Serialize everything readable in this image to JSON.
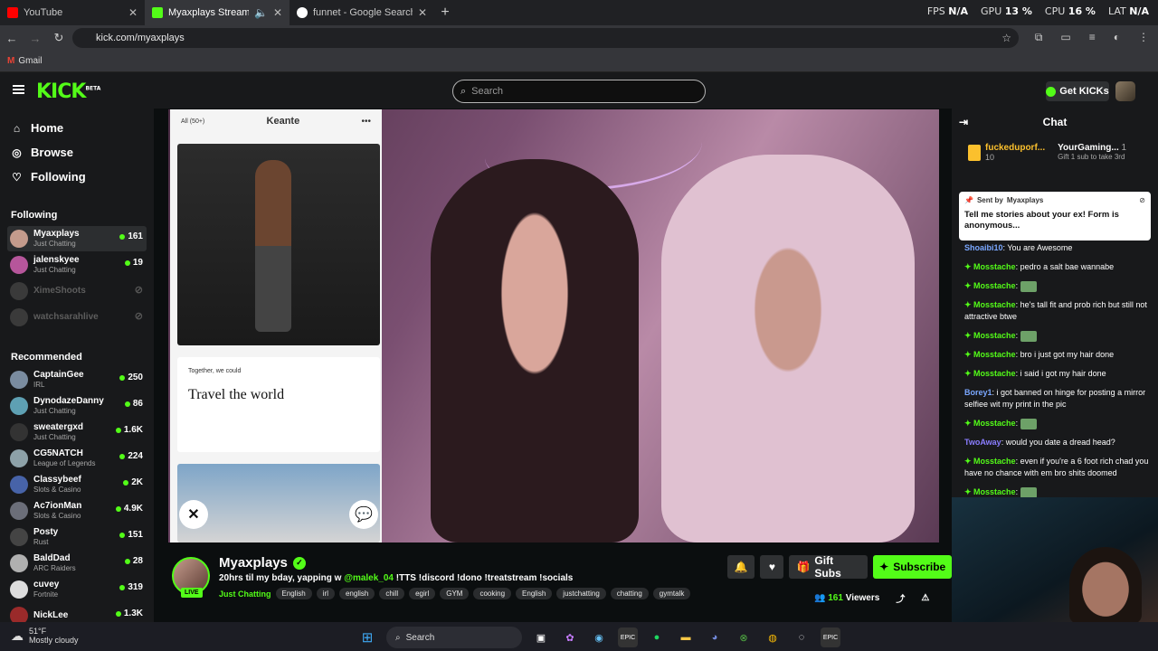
{
  "browser": {
    "tabs": [
      {
        "title": "YouTube"
      },
      {
        "title": "Myaxplays Stream - Watch"
      },
      {
        "title": "funnet - Google Search"
      }
    ],
    "url": "kick.com/myaxplays",
    "bookmark": "Gmail",
    "perf": {
      "fps_label": "FPS",
      "fps": "N/A",
      "gpu_label": "GPU",
      "gpu": "13 %",
      "cpu_label": "CPU",
      "cpu": "16 %",
      "lat_label": "LAT",
      "lat": "N/A"
    }
  },
  "site": {
    "logo": "KICK",
    "logo_badge": "BETA",
    "search_placeholder": "Search",
    "get_kicks": "Get KICKs"
  },
  "sidebar": {
    "nav": [
      {
        "label": "Home",
        "icon": "home-icon"
      },
      {
        "label": "Browse",
        "icon": "compass-icon"
      },
      {
        "label": "Following",
        "icon": "heart-icon"
      }
    ],
    "following_heading": "Following",
    "following": [
      {
        "name": "Myaxplays",
        "sub": "Just Chatting",
        "count": "161",
        "live": true
      },
      {
        "name": "jalenskyee",
        "sub": "Just Chatting",
        "count": "19",
        "live": true
      },
      {
        "name": "XimeShoots",
        "sub": "",
        "count": "",
        "live": false
      },
      {
        "name": "watchsarahlive",
        "sub": "",
        "count": "",
        "live": false
      }
    ],
    "recommended_heading": "Recommended",
    "recommended": [
      {
        "name": "CaptainGee",
        "sub": "IRL",
        "count": "250"
      },
      {
        "name": "DynodazeDanny",
        "sub": "Just Chatting",
        "count": "86"
      },
      {
        "name": "sweatergxd",
        "sub": "Just Chatting",
        "count": "1.6K"
      },
      {
        "name": "CG5NATCH",
        "sub": "League of Legends",
        "count": "224"
      },
      {
        "name": "Classybeef",
        "sub": "Slots & Casino",
        "count": "2K"
      },
      {
        "name": "Ac7ionMan",
        "sub": "Slots & Casino",
        "count": "4.9K"
      },
      {
        "name": "Posty",
        "sub": "Rust",
        "count": "151"
      },
      {
        "name": "BaldDad",
        "sub": "ARC Raiders",
        "count": "28"
      },
      {
        "name": "cuvey",
        "sub": "Fortnite",
        "count": "319"
      },
      {
        "name": "NickLee",
        "sub": "",
        "count": "1.3K"
      }
    ]
  },
  "player": {
    "phone_filter": "All (50+)",
    "phone_name": "Keante",
    "phone_prompt_q": "Together, we could",
    "phone_prompt_a": "Travel the world"
  },
  "stream": {
    "name": "Myaxplays",
    "live_badge": "LIVE",
    "title_pre": "20hrs til my bday, yapping w ",
    "title_mention": "@malek_04",
    "title_post": " !TTS !discord !dono !treatstream !socials",
    "category": "Just Chatting",
    "tags": [
      "English",
      "irl",
      "english",
      "chill",
      "egirl",
      "GYM",
      "cooking",
      "English",
      "justchatting",
      "chatting",
      "gymtalk"
    ],
    "gift_subs": "Gift Subs",
    "subscribe": "Subscribe",
    "viewers_count": "161",
    "viewers_label": "Viewers"
  },
  "chat": {
    "title": "Chat",
    "top_gifter_name": "fuckeduporf...",
    "top_gifter_count": "10",
    "second_gifter_name": "YourGaming...",
    "second_gifter_count": "1",
    "second_gifter_sub": "Gift 1 sub to take 3rd",
    "pinned_by_label": "Sent by",
    "pinned_by": "Myaxplays",
    "pinned_msg": "Tell me stories about your ex! Form is anonymous...",
    "messages": [
      {
        "user": "Shoaibi10",
        "color": "#7aa7ff",
        "mod": false,
        "text": "You are Awesome"
      },
      {
        "user": "Mosstache",
        "color": "#53fc18",
        "mod": true,
        "text": "pedro a salt bae wannabe"
      },
      {
        "user": "Mosstache",
        "color": "#53fc18",
        "mod": true,
        "text": ""
      },
      {
        "user": "Mosstache",
        "color": "#53fc18",
        "mod": true,
        "text": "he's tall fit and prob rich but still not attractive btwe"
      },
      {
        "user": "Mosstache",
        "color": "#53fc18",
        "mod": true,
        "text": ""
      },
      {
        "user": "Mosstache",
        "color": "#53fc18",
        "mod": true,
        "text": "bro i just got my hair done"
      },
      {
        "user": "Mosstache",
        "color": "#53fc18",
        "mod": true,
        "text": "i said i got my hair done"
      },
      {
        "user": "Borey1",
        "color": "#7aa7ff",
        "mod": false,
        "text": "i got banned on hinge for posting a mirror selfiee wit my print in the pic"
      },
      {
        "user": "Mosstache",
        "color": "#53fc18",
        "mod": true,
        "text": ""
      },
      {
        "user": "TwoAway",
        "color": "#8a7dff",
        "mod": false,
        "text": "would you date a dread head?"
      },
      {
        "user": "Mosstache",
        "color": "#53fc18",
        "mod": true,
        "text": "even if you're a 6 foot rich chad you have no chance with em bro shits doomed"
      },
      {
        "user": "Mosstache",
        "color": "#53fc18",
        "mod": true,
        "text": ""
      }
    ]
  },
  "taskbar": {
    "temp": "51°F",
    "weather": "Mostly cloudy",
    "search": "Search"
  }
}
